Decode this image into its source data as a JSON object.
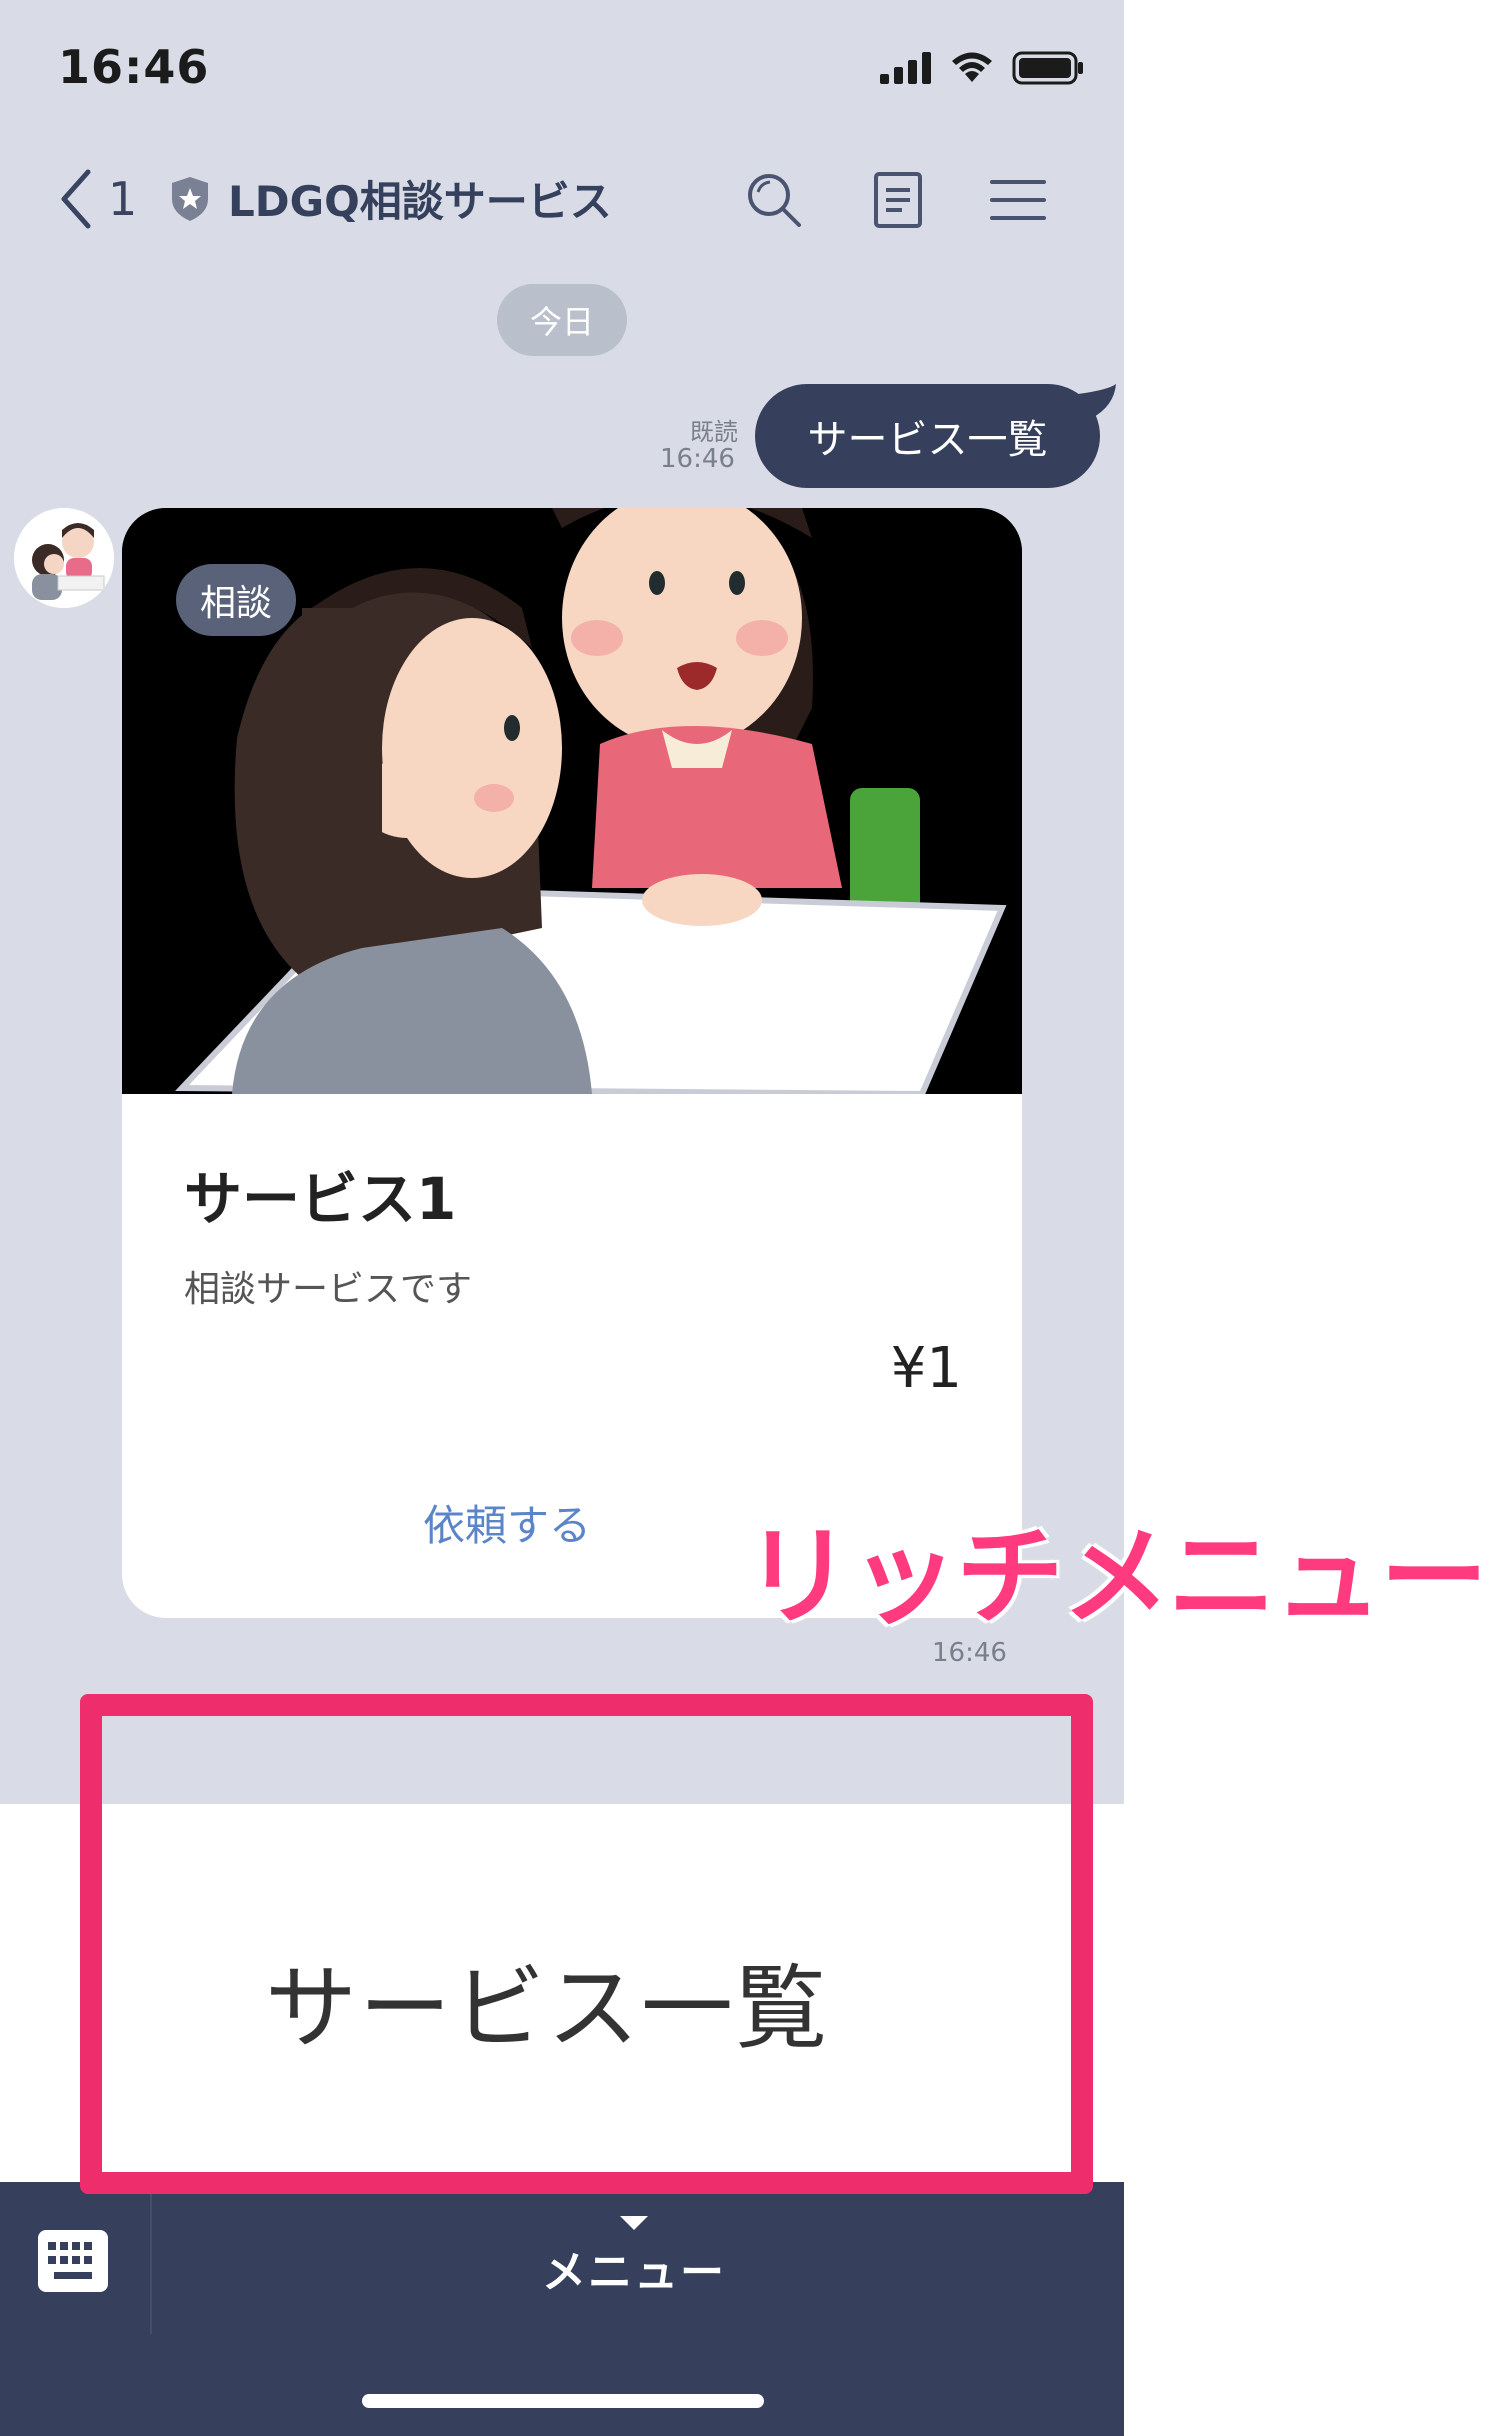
{
  "status_bar": {
    "time": "16:46"
  },
  "header": {
    "back_count": "1",
    "title": "LDGQ相談サービス"
  },
  "chat": {
    "date_label": "今日",
    "sent": {
      "read_label": "既読",
      "time": "16:46",
      "text": "サービス一覧"
    },
    "card": {
      "tag": "相談",
      "title": "サービス1",
      "description": "相談サービスです",
      "price": "¥1",
      "action_label": "依頼する",
      "time": "16:46"
    }
  },
  "rich_menu": {
    "label": "サービス一覧"
  },
  "bottom_bar": {
    "menu_label": "メニュー"
  },
  "annotation": {
    "text": "リッチメニュー",
    "color": "#ee2d6d"
  },
  "colors": {
    "header_dark": "#36405c",
    "chat_bg": "#d9dce6",
    "link": "#5b85c8"
  }
}
